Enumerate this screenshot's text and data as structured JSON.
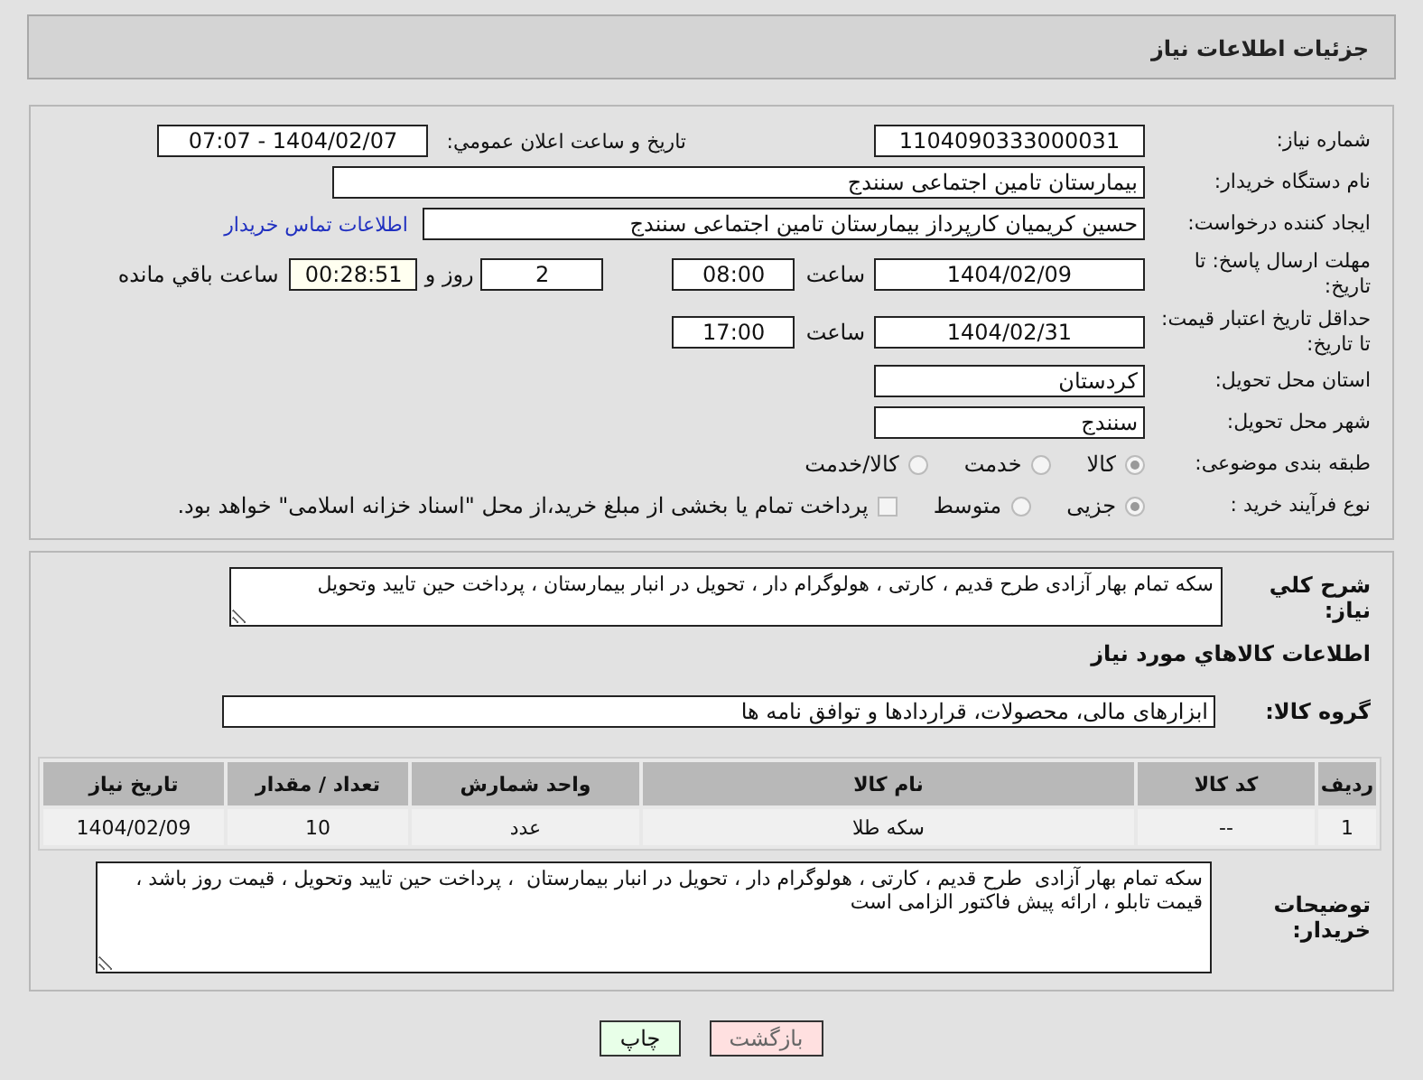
{
  "header": {
    "title": "جزئیات اطلاعات نیاز"
  },
  "details": {
    "need_number": {
      "label": "شماره نیاز:",
      "value": "1104090333000031"
    },
    "announce": {
      "label": "تاریخ و ساعت اعلان عمومي:",
      "value": "1404/02/07 - 07:07"
    },
    "buyer_org": {
      "label": "نام دستگاه خریدار:",
      "value": "بیمارستان تامین اجتماعی سنندج"
    },
    "requester": {
      "label": "ایجاد کننده درخواست:",
      "value": "حسین کریمیان کارپرداز بیمارستان تامین اجتماعی سنندج"
    },
    "contact_link": "اطلاعات تماس خریدار",
    "deadline": {
      "label": "مهلت ارسال پاسخ: تا تاریخ:",
      "date": "1404/02/09",
      "time_label": "ساعت",
      "time": "08:00",
      "days": "2",
      "days_label": "روز و",
      "remaining": "00:28:51",
      "remaining_label": "ساعت باقي مانده"
    },
    "validity": {
      "label": "حداقل تاریخ اعتبار قیمت: تا تاریخ:",
      "date": "1404/02/31",
      "time_label": "ساعت",
      "time": "17:00"
    },
    "province": {
      "label": "استان محل تحویل:",
      "value": "کردستان"
    },
    "city": {
      "label": "شهر محل تحویل:",
      "value": "سنندج"
    },
    "category": {
      "label": "طبقه بندی موضوعی:",
      "options": [
        {
          "label": "کالا",
          "selected": true
        },
        {
          "label": "خدمت",
          "selected": false
        },
        {
          "label": "کالا/خدمت",
          "selected": false
        }
      ]
    },
    "process": {
      "label": "نوع فرآیند خرید :",
      "options": [
        {
          "label": "جزیی",
          "selected": true
        },
        {
          "label": "متوسط",
          "selected": false
        }
      ],
      "treasury": {
        "label": "پرداخت تمام یا بخشی از مبلغ خرید،از محل \"اسناد خزانه اسلامی\" خواهد بود.",
        "checked": false
      }
    }
  },
  "summary": {
    "label": "شرح کلي نیاز:",
    "value": "سکه تمام بهار آزادی  طرح قدیم ، کارتی ، هولوگرام دار ، تحویل در انبار بیمارستان  ، پرداخت حین تایید وتحویل"
  },
  "goods": {
    "title": "اطلاعات کالاهاي مورد نیاز",
    "group_label": "گروه کالا:",
    "group": "ابزارهای مالی، محصولات، قراردادها و توافق نامه ها",
    "table": {
      "columns": [
        "ردیف",
        "کد کالا",
        "نام کالا",
        "واحد شمارش",
        "تعداد / مقدار",
        "تاریخ نیاز"
      ],
      "rows": [
        [
          "1",
          "--",
          "سکه طلا",
          "عدد",
          "10",
          "1404/02/09"
        ]
      ]
    }
  },
  "buyer_notes": {
    "label": "توضیحات خریدار:",
    "value": "سکه تمام بهار آزادی  طرح قدیم ، کارتی ، هولوگرام دار ، تحویل در انبار بیمارستان  ، پرداخت حین تایید وتحویل ، قیمت روز باشد ، قیمت تابلو ، ارائه پیش فاکتور الزامی است"
  },
  "buttons": [
    {
      "label": "بازگشت",
      "kind": "back"
    },
    {
      "label": "چاپ",
      "kind": "print"
    }
  ]
}
